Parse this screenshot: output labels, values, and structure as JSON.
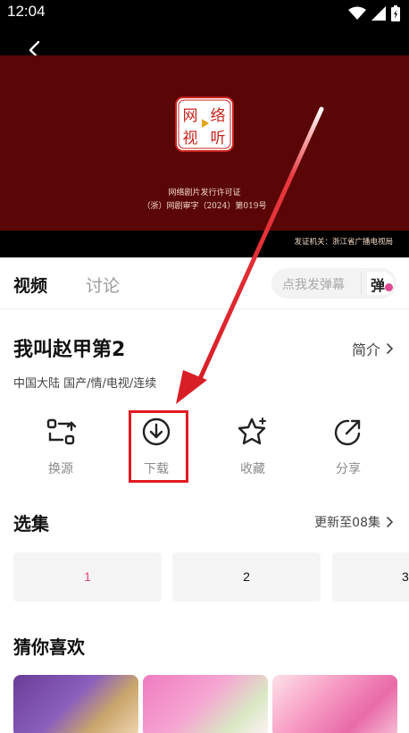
{
  "status_bar": {
    "time": "12:04"
  },
  "video": {
    "license_title": "网络剧片发行许可证",
    "license_number": "（浙）网剧审字（2024）第019号",
    "issuer": "发证机关：浙江省广播电视局",
    "seal_chars": [
      "网",
      "络",
      "视",
      "听"
    ]
  },
  "tabs": {
    "video": "视频",
    "discuss": "讨论"
  },
  "danmu": {
    "placeholder": "点我发弹幕",
    "button": "弹"
  },
  "show": {
    "title": "我叫赵甲第2",
    "intro": "简介",
    "meta": "中国大陆  国产/情/电视/连续"
  },
  "actions": {
    "switch_source": "换源",
    "download": "下载",
    "favorite": "收藏",
    "share": "分享"
  },
  "episodes": {
    "title": "选集",
    "updates": "更新至08集",
    "items": [
      "1",
      "2",
      "3"
    ]
  },
  "recommend": {
    "title": "猜你喜欢"
  },
  "colors": {
    "accent_pink": "#e2457f",
    "highlight_red": "#e11b22",
    "license_bg": "#5a0606"
  }
}
